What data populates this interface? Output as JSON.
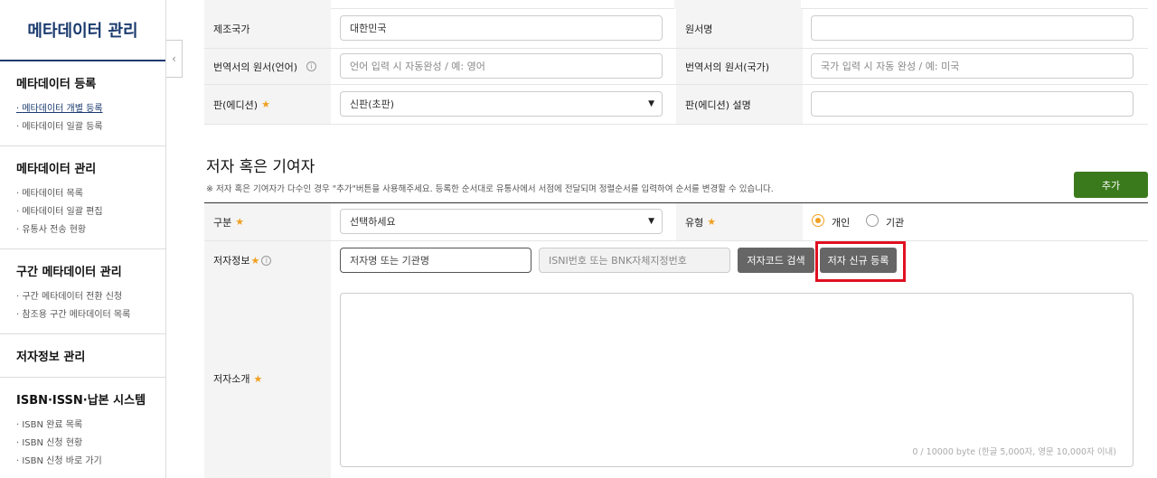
{
  "sidebar": {
    "brand": "메타데이터 관리",
    "sections": [
      {
        "title": "메타데이터 등록",
        "items": [
          "메타데이터 개별 등록",
          "메타데이터 일괄 등록"
        ]
      },
      {
        "title": "메타데이터 관리",
        "items": [
          "메타데이터 목록",
          "메타데이터 일괄 편집",
          "유통사 전송 현황"
        ]
      },
      {
        "title": "구간 메타데이터 관리",
        "items": [
          "구간 메타데이터 전환 신청",
          "참조용 구간 메타데이터 목록"
        ]
      },
      {
        "title": "저자정보 관리",
        "items": []
      },
      {
        "title": "ISBN·ISSN·납본 시스템",
        "items": [
          "ISBN 완료 목록",
          "ISBN 신청 현황",
          "ISBN 신청 바로 가기"
        ]
      }
    ],
    "collapse_glyph": "‹"
  },
  "form": {
    "country_label": "제조국가",
    "country_value": "대한민국",
    "orig_title_label": "원서명",
    "orig_title_value": "",
    "orig_lang_label": "번역서의 원서(언어)",
    "orig_lang_placeholder": "언어 입력 시 자동완성 / 예: 영어",
    "orig_country_label": "번역서의 원서(국가)",
    "orig_country_placeholder": "국가 입력 시 자동 완성 / 예: 미국",
    "edition_label": "판(에디션)",
    "edition_value": "신판(초판)",
    "edition_desc_label": "판(에디션) 설명",
    "edition_desc_value": ""
  },
  "author_section": {
    "title": "저자 혹은 기여자",
    "note": "※ 저자 혹은 기여자가 다수인 경우 \"추가\"버튼을 사용해주세요. 등록한 순서대로 유통사에서 서점에 전달되며 정렬순서를 입력하여 순서를 변경할 수 있습니다.",
    "add_label": "추가",
    "category_label": "구분",
    "category_value": "선택하세요",
    "type_label": "유형",
    "type_options": [
      "개인",
      "기관"
    ],
    "type_selected": "개인",
    "info_label": "저자정보",
    "name_placeholder": "저자명 또는 기관명",
    "isni_placeholder": "ISNI번호 또는 BNK자체지정번호",
    "search_label": "저자코드 검색",
    "register_label": "저자 신규 등록",
    "intro_label": "저자소개",
    "counter": "0 / 10000 byte (한글 5,000자, 영문 10,000자 이내)"
  },
  "colors": {
    "brand": "#1a3a6e",
    "add_button": "#3b7a1c",
    "required": "#f0a020",
    "highlight": "#e01020"
  },
  "icons": {
    "info": "info-icon",
    "dropdown": "caret-down-icon",
    "collapse": "chevron-left-icon"
  }
}
